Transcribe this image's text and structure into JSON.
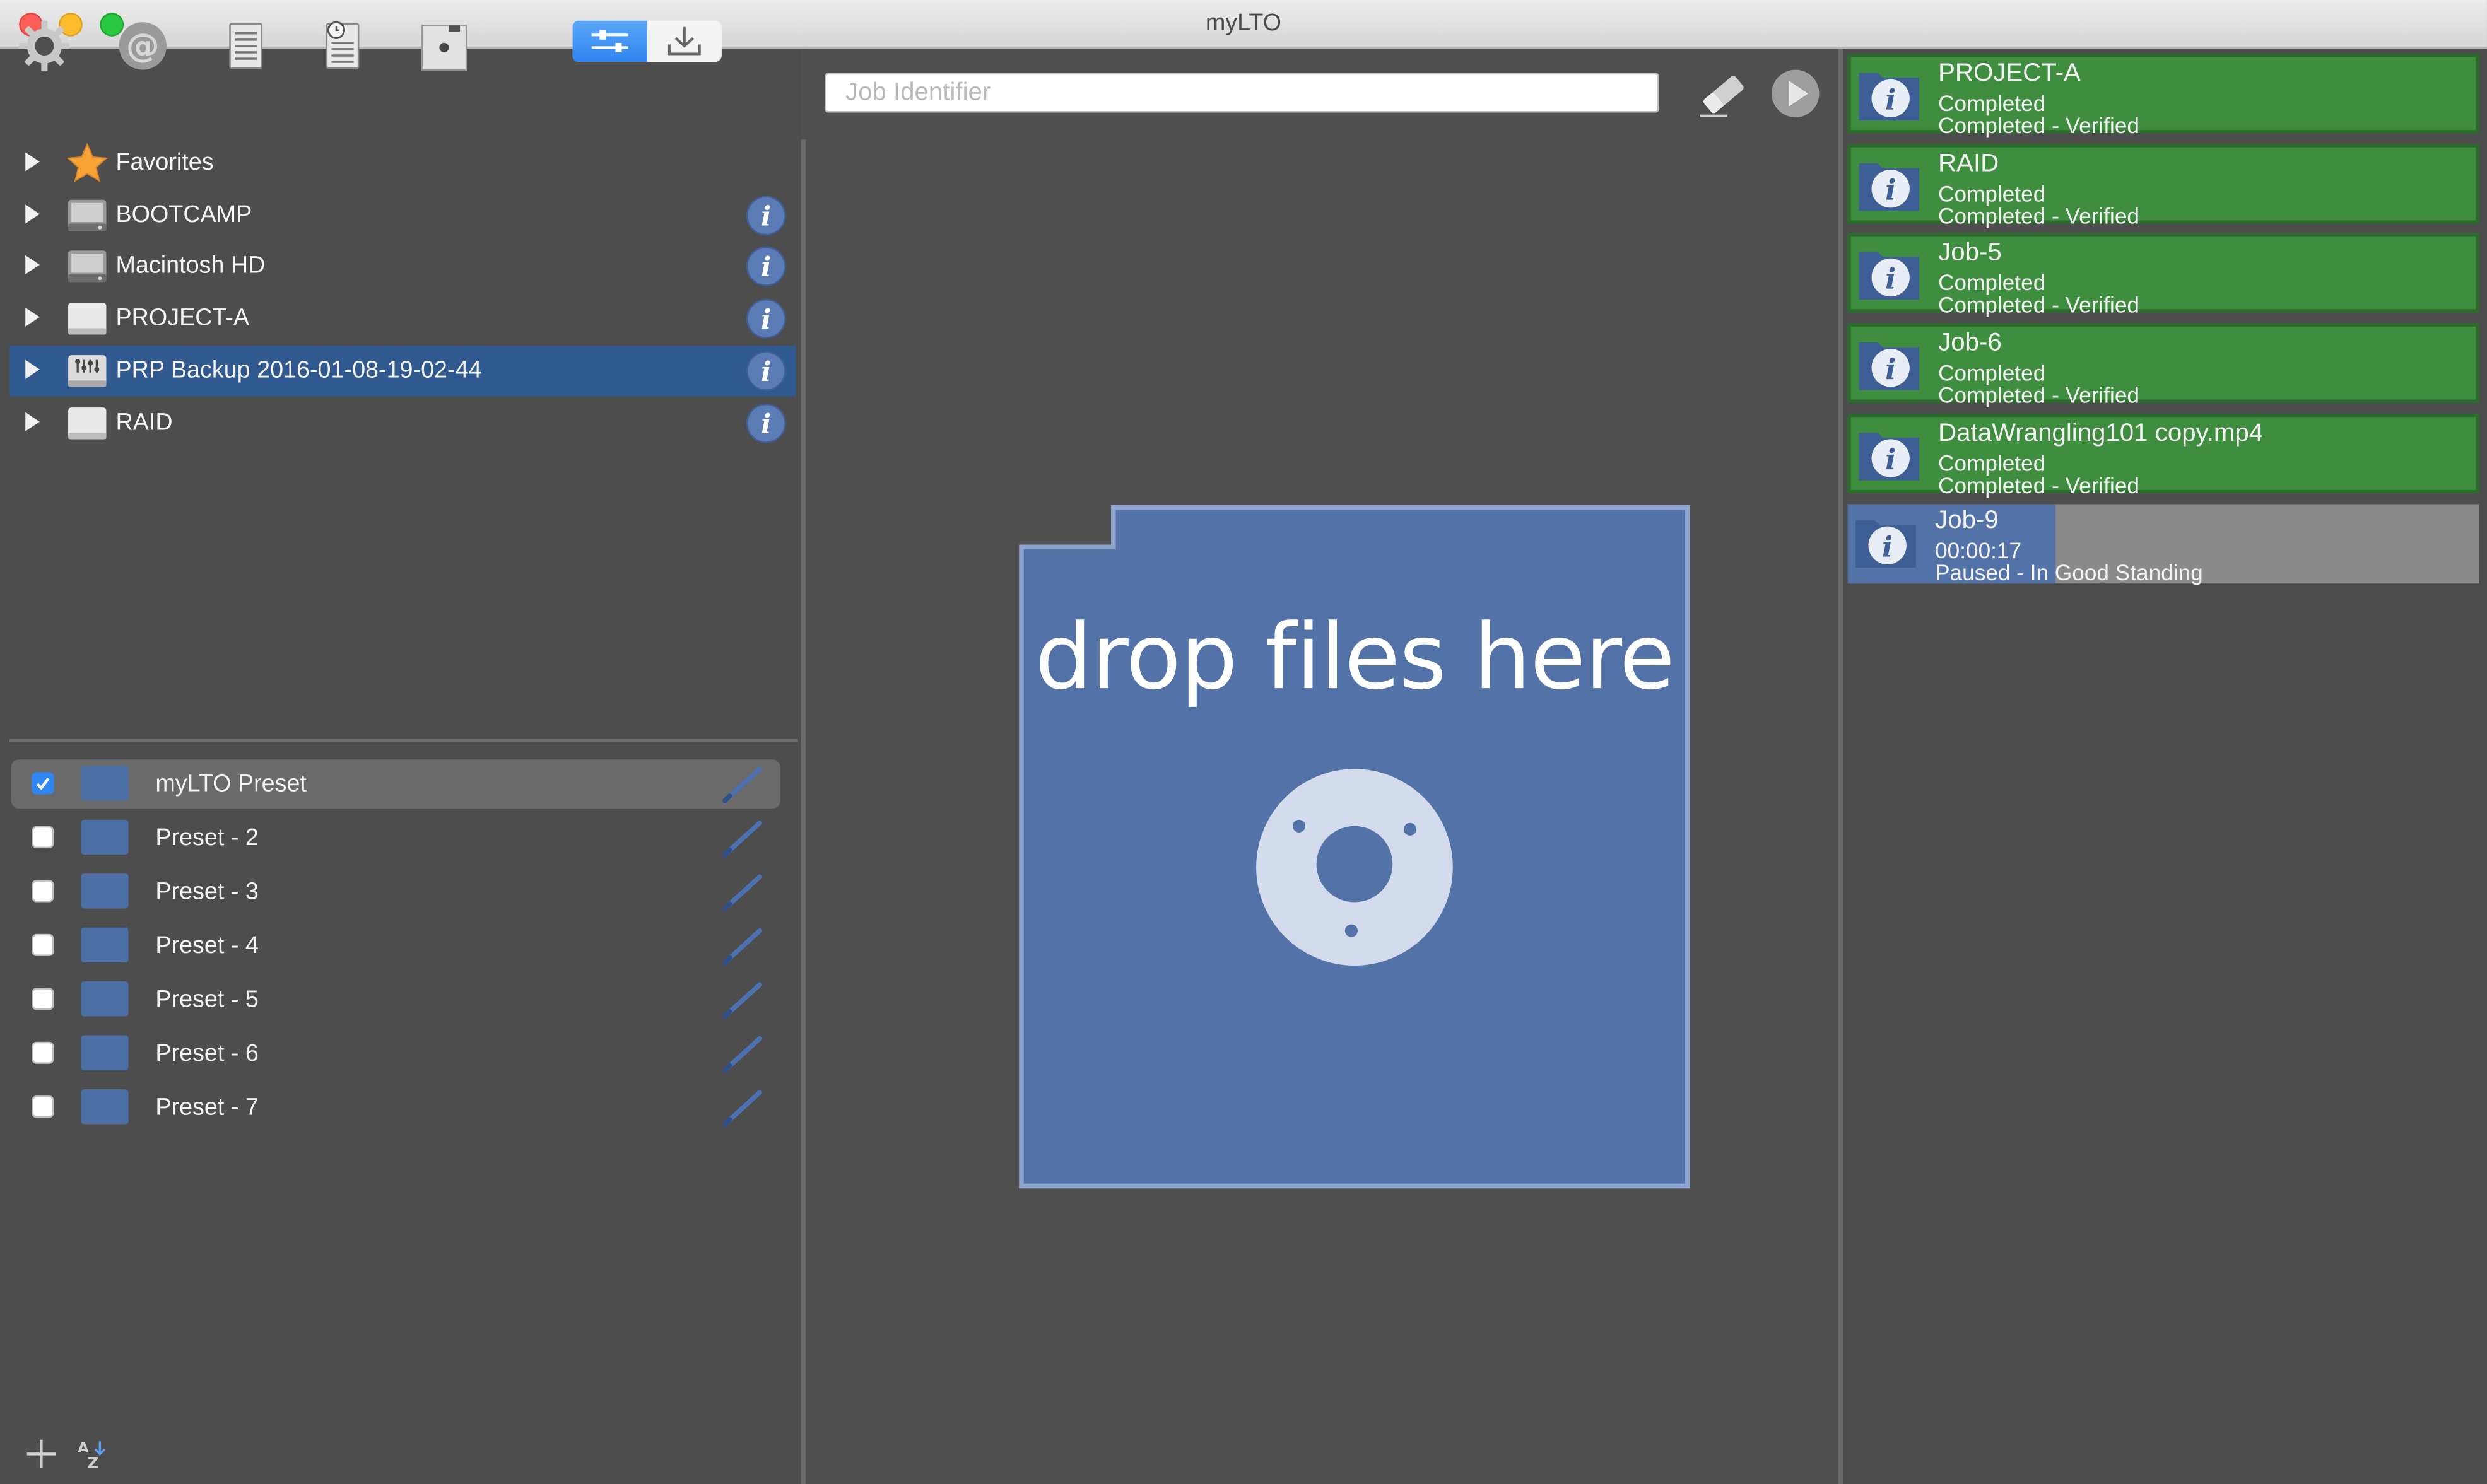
{
  "window": {
    "title": "myLTO"
  },
  "toolbar": {
    "icons": [
      "gear-icon",
      "at-icon",
      "document-list-icon",
      "document-clock-icon",
      "tape-drive-icon"
    ],
    "segmented": [
      "sliders-icon",
      "download-icon"
    ],
    "search_placeholder": "Job Identifier",
    "right_icons": [
      "eraser-icon",
      "play-icon"
    ]
  },
  "sidebar": {
    "tree": [
      {
        "label": "Favorites",
        "icon": "star-icon",
        "info": false,
        "selected": false
      },
      {
        "label": "BOOTCAMP",
        "icon": "internal-drive-icon",
        "info": true,
        "selected": false
      },
      {
        "label": "Macintosh HD",
        "icon": "internal-drive-icon",
        "info": true,
        "selected": false
      },
      {
        "label": "PROJECT-A",
        "icon": "external-drive-icon",
        "info": true,
        "selected": false
      },
      {
        "label": "PRP Backup 2016-01-08-19-02-44",
        "icon": "network-drive-icon",
        "info": true,
        "selected": true
      },
      {
        "label": "RAID",
        "icon": "external-drive-icon",
        "info": true,
        "selected": false
      }
    ],
    "presets": [
      {
        "label": "myLTO Preset",
        "checked": true,
        "selected": true
      },
      {
        "label": "Preset - 2",
        "checked": false,
        "selected": false
      },
      {
        "label": "Preset - 3",
        "checked": false,
        "selected": false
      },
      {
        "label": "Preset - 4",
        "checked": false,
        "selected": false
      },
      {
        "label": "Preset - 5",
        "checked": false,
        "selected": false
      },
      {
        "label": "Preset - 6",
        "checked": false,
        "selected": false
      },
      {
        "label": "Preset - 7",
        "checked": false,
        "selected": false
      }
    ],
    "bottom_icons": [
      "add-icon",
      "sort-az-icon"
    ]
  },
  "dropzone": {
    "label": "drop files here"
  },
  "jobs": [
    {
      "name": "PROJECT-A",
      "line2": "Completed",
      "line3": "Completed - Verified",
      "state": "done"
    },
    {
      "name": "RAID",
      "line2": "Completed",
      "line3": "Completed - Verified",
      "state": "done"
    },
    {
      "name": "Job-5",
      "line2": "Completed",
      "line3": "Completed - Verified",
      "state": "done"
    },
    {
      "name": "Job-6",
      "line2": "Completed",
      "line3": "Completed - Verified",
      "state": "done"
    },
    {
      "name": "DataWrangling101 copy.mp4",
      "line2": "Completed",
      "line3": "Completed - Verified",
      "state": "done"
    },
    {
      "name": "Job-9",
      "line2": "00:00:17",
      "line3": "Paused - In Good Standing",
      "state": "paused",
      "progress": 0.33
    }
  ],
  "colors": {
    "accent": "#2f86f0",
    "job_done": "#3f8d3f",
    "job_paused": "#8a8a8a",
    "selection": "#30598f",
    "dropzone": "#5373a8"
  }
}
